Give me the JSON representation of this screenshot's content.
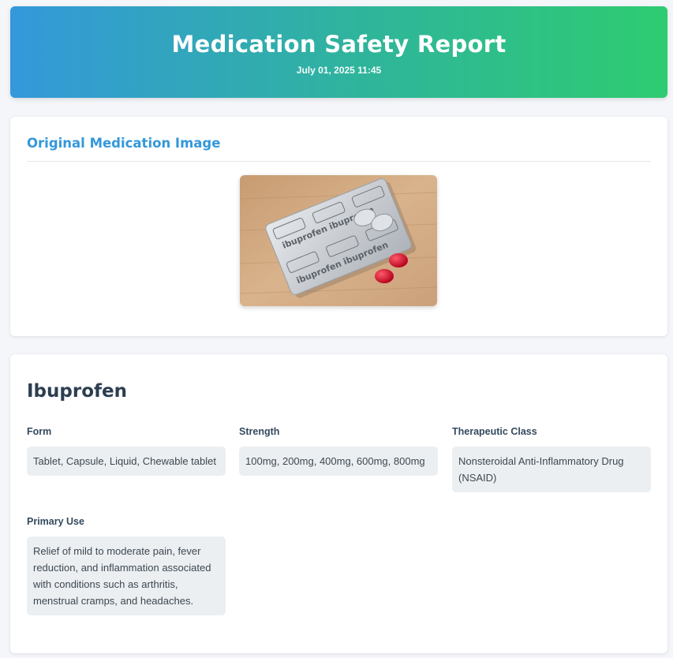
{
  "header": {
    "title": "Medication Safety Report",
    "date": "July 01, 2025 11:45"
  },
  "image_section": {
    "title": "Original Medication Image",
    "photo_label": "Ibuprofen",
    "photo_icon": "medication-photo"
  },
  "medication": {
    "name": "Ibuprofen",
    "form_label": "Form",
    "form_value": "Tablet, Capsule, Liquid, Chewable tablet",
    "strength_label": "Strength",
    "strength_value": "100mg, 200mg, 400mg, 600mg, 800mg",
    "class_label": "Therapeutic Class",
    "class_value": "Nonsteroidal Anti-Inflammatory Drug (NSAID)",
    "use_label": "Primary Use",
    "use_value": "Relief of mild to moderate pain, fever reduction, and inflammation associated with conditions such as arthritis, menstrual cramps, and headaches."
  },
  "colors": {
    "gradient_start": "#3498db",
    "gradient_end": "#2ecc71",
    "section_title": "#3498db"
  }
}
